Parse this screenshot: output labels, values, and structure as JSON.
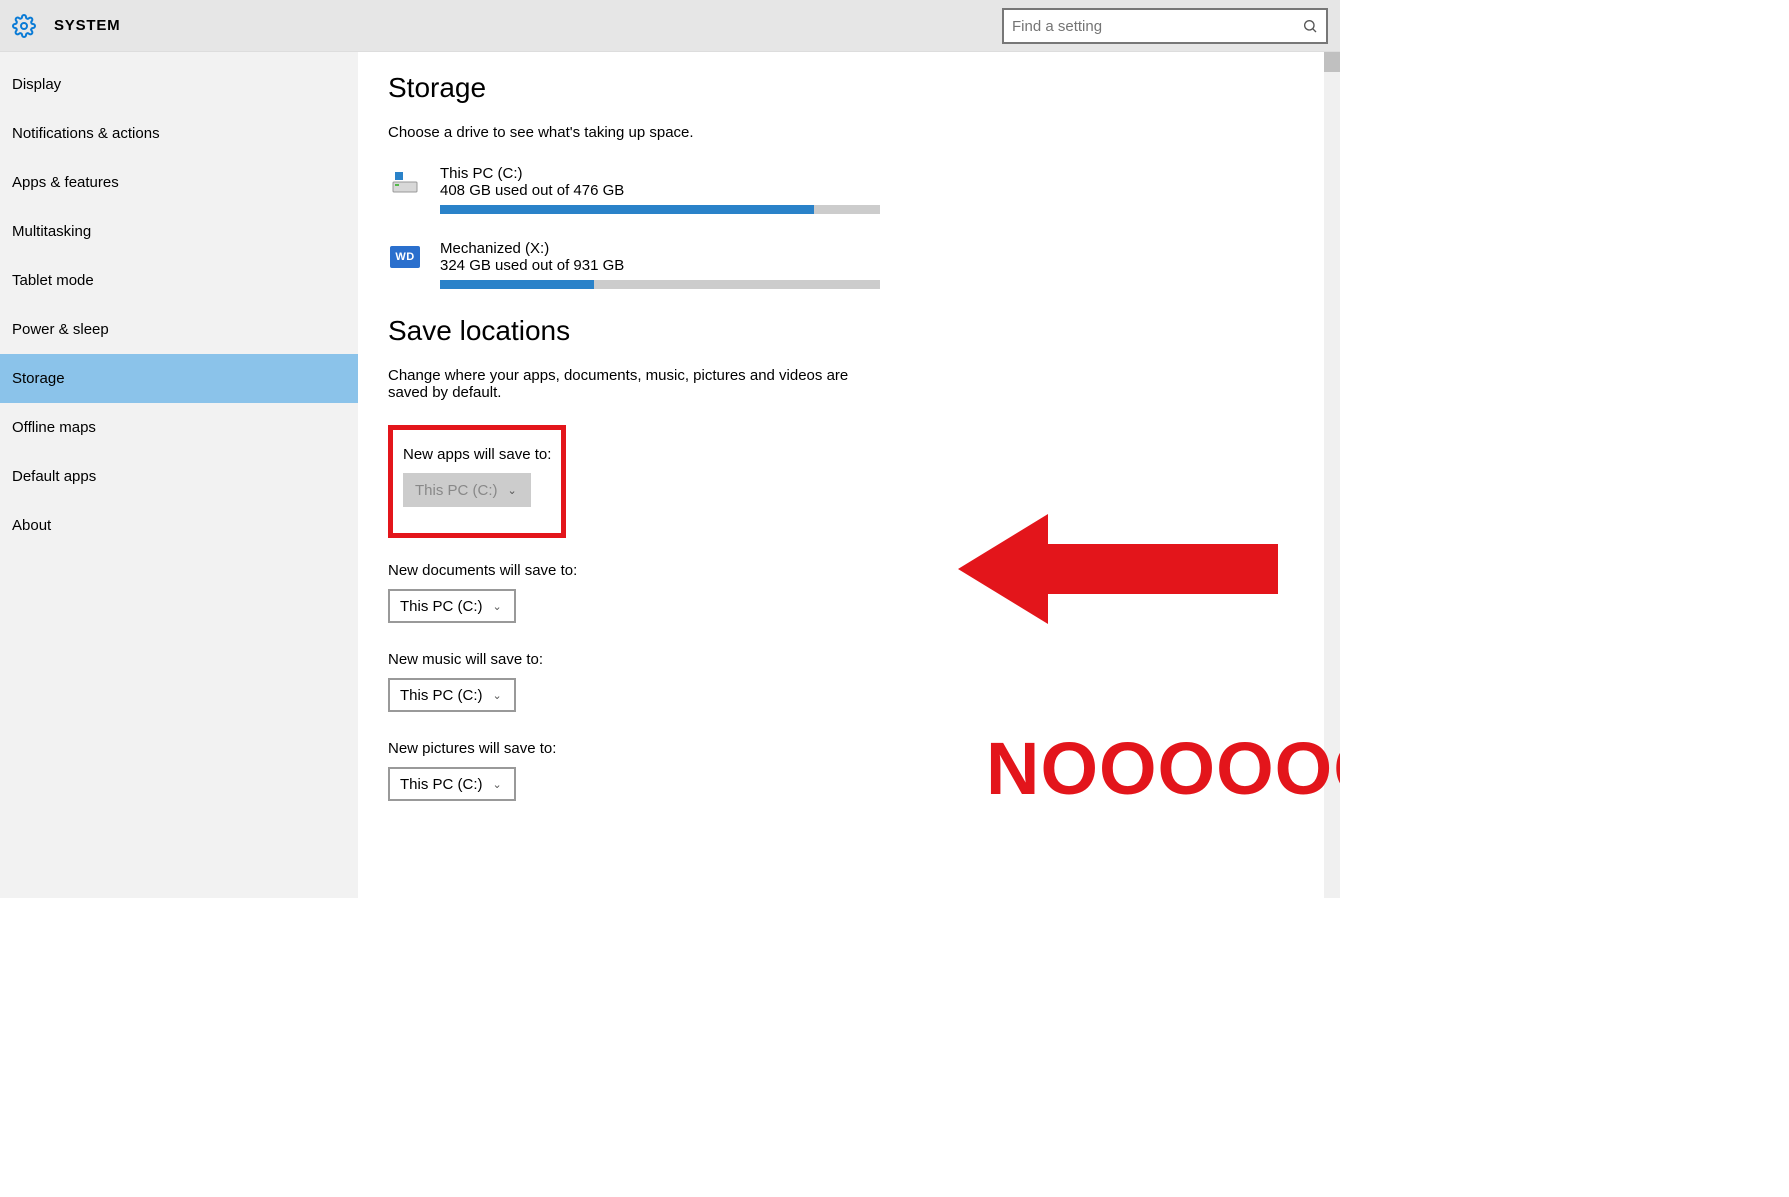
{
  "header": {
    "title": "SYSTEM"
  },
  "search": {
    "placeholder": "Find a setting"
  },
  "sidebar": {
    "items": [
      {
        "label": "Display",
        "selected": false
      },
      {
        "label": "Notifications & actions",
        "selected": false
      },
      {
        "label": "Apps & features",
        "selected": false
      },
      {
        "label": "Multitasking",
        "selected": false
      },
      {
        "label": "Tablet mode",
        "selected": false
      },
      {
        "label": "Power & sleep",
        "selected": false
      },
      {
        "label": "Storage",
        "selected": true
      },
      {
        "label": "Offline maps",
        "selected": false
      },
      {
        "label": "Default apps",
        "selected": false
      },
      {
        "label": "About",
        "selected": false
      }
    ]
  },
  "storage": {
    "title": "Storage",
    "subtitle": "Choose a drive to see what's taking up space.",
    "drives": [
      {
        "name": "This PC (C:)",
        "used_text": "408 GB used out of 476 GB",
        "fill_pct": 85,
        "icon": "disk"
      },
      {
        "name": "Mechanized (X:)",
        "used_text": "324 GB used out of 931 GB",
        "fill_pct": 35,
        "icon": "wd"
      }
    ]
  },
  "save_locations": {
    "title": "Save locations",
    "subtitle": "Change where your apps, documents, music, pictures and videos are saved by default.",
    "items": [
      {
        "label": "New apps will save to:",
        "value": "This PC (C:)",
        "disabled": true,
        "highlighted": true
      },
      {
        "label": "New documents will save to:",
        "value": "This PC (C:)",
        "disabled": false
      },
      {
        "label": "New music will save to:",
        "value": "This PC (C:)",
        "disabled": false
      },
      {
        "label": "New pictures will save to:",
        "value": "This PC (C:)",
        "disabled": false
      }
    ]
  },
  "annotation": {
    "text": "NOOOOOOO!"
  },
  "colors": {
    "accent_red": "#e3151b",
    "bar_blue": "#2a82c9",
    "sidebar_sel": "#8bc3ea"
  }
}
